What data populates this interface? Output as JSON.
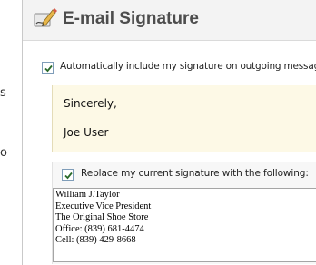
{
  "left_edge": {
    "chars": [
      "s",
      "o"
    ]
  },
  "header": {
    "title": "E-mail Signature",
    "icon": "pen-writing-icon"
  },
  "auto_include": {
    "checked": true,
    "label": "Automatically include my signature on outgoing messages"
  },
  "preview": {
    "lines": [
      "Sincerely,",
      "Joe User"
    ]
  },
  "replace": {
    "checked": true,
    "label": "Replace my current signature with the following:",
    "textarea_lines": [
      "William J.Taylor",
      "Executive Vice President",
      "The Original Shoe Store",
      "Office: (839) 681-4474",
      "Cell: (839) 429-8668"
    ]
  },
  "colors": {
    "title": "#4d4d4d",
    "preview_bg": "#fdf9e6",
    "check_mark": "#2a6a2a"
  }
}
